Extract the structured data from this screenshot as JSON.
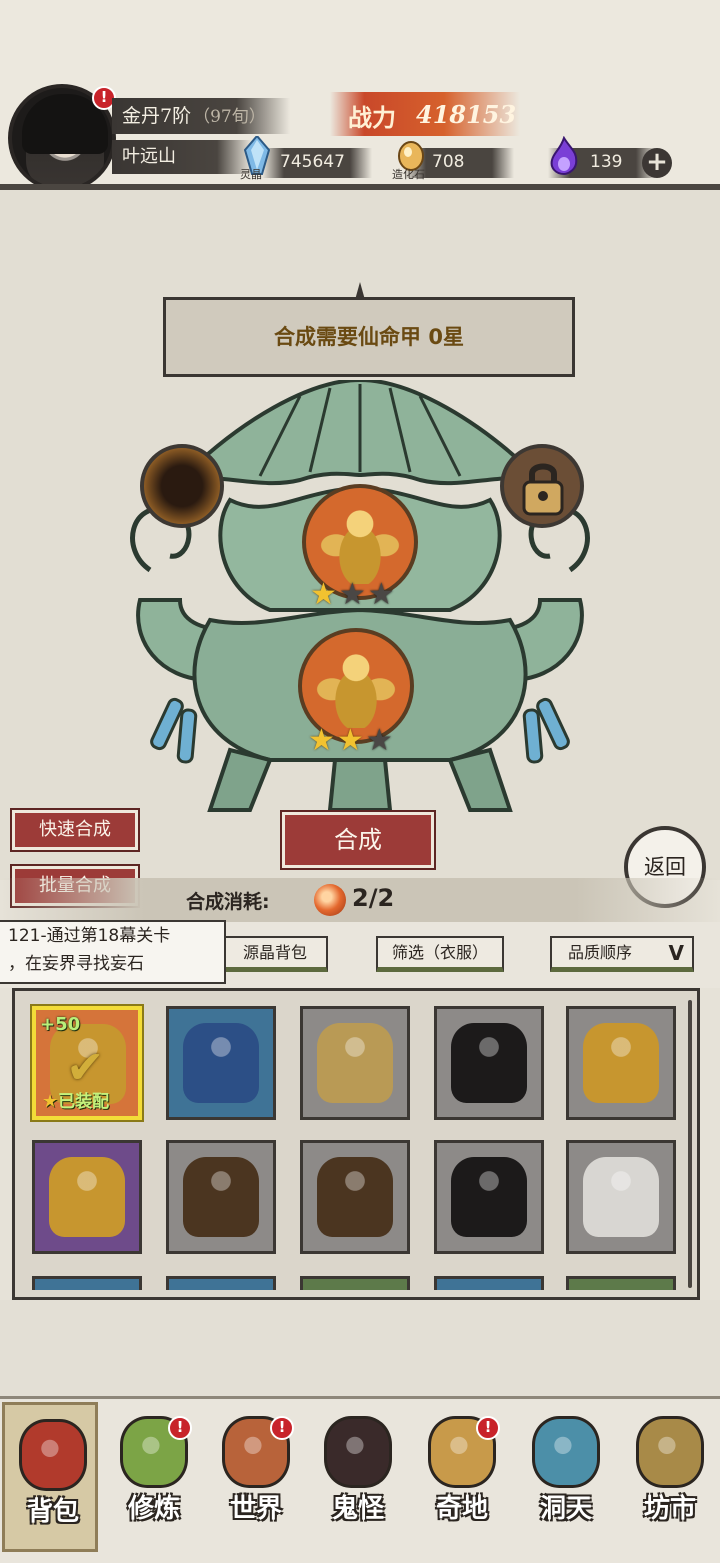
{
  "header": {
    "rank": "金丹7阶",
    "age": "（97旬）",
    "player_name": "叶远山",
    "power_label": "战力",
    "power_value": "418153",
    "resources": [
      {
        "icon": "spirit-crystal-icon",
        "caption": "灵晶",
        "value": "745647"
      },
      {
        "icon": "creation-stone-icon",
        "caption": "造化石",
        "value": "708"
      },
      {
        "icon": "purple-flame-icon",
        "caption": "",
        "value": "139"
      }
    ],
    "avatar_alert": "!"
  },
  "merge": {
    "requirement": "合成需要仙命甲 0星",
    "slot_top": {
      "icon": "golden-armor-icon",
      "stars": [
        true,
        false,
        false
      ]
    },
    "slot_bottom": {
      "icon": "golden-armor-icon",
      "stars": [
        true,
        true,
        false
      ]
    },
    "left_orb": "empty-vortex-icon",
    "right_orb": "lock-icon",
    "merge_button": "合成",
    "cost_label": "合成消耗:",
    "cost_value": "2/2"
  },
  "side_buttons": {
    "quick_merge": "快速合成",
    "batch_merge": "批量合成",
    "back": "返回"
  },
  "quest": {
    "line1": "121-通过第18幕关卡",
    "line2": "，在妄界寻找妄石"
  },
  "filters": {
    "bag": "源晶背包",
    "filter": "筛选（衣服）",
    "sort": "品质顺序",
    "sort_chevron": "V"
  },
  "inventory": {
    "items": [
      {
        "name": "golden-armor",
        "bg": "#d5743a",
        "art": "#c7962f",
        "plus": "+50",
        "equipped_label": "已装配",
        "star": "★"
      },
      {
        "name": "blue-robe",
        "bg": "#3f7396",
        "art": "#2c4f86"
      },
      {
        "name": "silver-gold-armor",
        "bg": "#8d8a88",
        "art": "#b99a55"
      },
      {
        "name": "red-black-robe",
        "bg": "#8d8a88",
        "art": "#1c1a1a"
      },
      {
        "name": "golden-armor",
        "bg": "#8d8a88",
        "art": "#c7962f"
      },
      {
        "name": "golden-armor",
        "bg": "#6e4b8a",
        "art": "#c7962f"
      },
      {
        "name": "dark-brown-robe",
        "bg": "#8d8a88",
        "art": "#4b3520"
      },
      {
        "name": "dark-brown-robe",
        "bg": "#8d8a88",
        "art": "#4b3520"
      },
      {
        "name": "red-black-robe",
        "bg": "#8d8a88",
        "art": "#1c1a1a"
      },
      {
        "name": "white-robe",
        "bg": "#8d8a88",
        "art": "#d8d6d2"
      }
    ]
  },
  "nav": [
    {
      "label": "背包",
      "icon": "bag-icon",
      "color": "#b13a2c",
      "alert": false,
      "active": true
    },
    {
      "label": "修炼",
      "icon": "cultivate-icon",
      "color": "#7ca446",
      "alert": true,
      "active": false
    },
    {
      "label": "世界",
      "icon": "world-scroll-icon",
      "color": "#b8633a",
      "alert": true,
      "active": false
    },
    {
      "label": "鬼怪",
      "icon": "demon-egg-icon",
      "color": "#3a2a2a",
      "alert": false,
      "active": false
    },
    {
      "label": "奇地",
      "icon": "wonder-land-icon",
      "color": "#c89a4a",
      "alert": true,
      "active": false
    },
    {
      "label": "洞天",
      "icon": "cave-heaven-icon",
      "color": "#4c8fa8",
      "alert": false,
      "active": false
    },
    {
      "label": "坊市",
      "icon": "market-icon",
      "color": "#a88a48",
      "alert": false,
      "active": false
    }
  ],
  "colors": {
    "accent_red": "#9c3b38",
    "power_orange": "#d6612c",
    "equipped_gold": "#f3dc38",
    "cauldron_green": "#8fb39a"
  }
}
